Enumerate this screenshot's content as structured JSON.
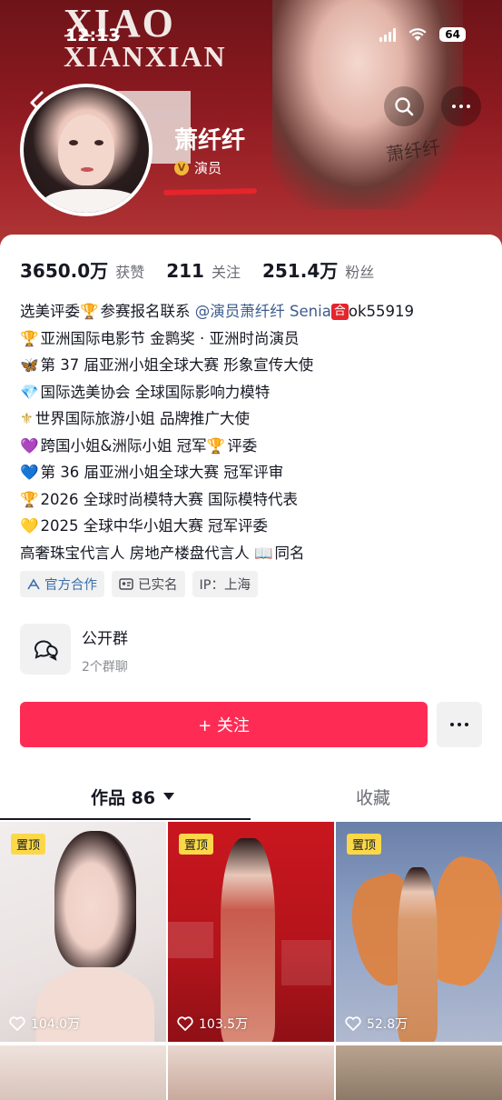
{
  "status": {
    "time": "12:13",
    "battery": "64"
  },
  "banner": {
    "line1": "XIAO",
    "line2": "XIANXIAN",
    "signature": "萧纤纤"
  },
  "profile": {
    "nickname": "萧纤纤",
    "verify_label": "演员",
    "verify_badge": "V"
  },
  "stats": [
    {
      "value": "3650.0万",
      "label": "获赞"
    },
    {
      "value": "211",
      "label": "关注"
    },
    {
      "value": "251.4万",
      "label": "粉丝"
    }
  ],
  "bio": {
    "l1a": "选美评委",
    "l1b": "参赛报名联系",
    "l1_mention": "@演员萧纤纤 Senia",
    "l1_tag": "合",
    "l1c": "ok55919",
    "l2": "亚洲国际电影节 金鹮奖 · 亚洲时尚演员",
    "l3": "第 37 届亚洲小姐全球大赛 形象宣传大使",
    "l4": "国际选美协会 全球国际影响力模特",
    "l5": "世界国际旅游小姐 品牌推广大使",
    "l6a": "跨国小姐&洲际小姐 冠军",
    "l6b": "评委",
    "l7": "第 36 届亚洲小姐全球大赛 冠军评审",
    "l8": "2026 全球时尚模特大赛 国际模特代表",
    "l9": "2025 全球中华小姐大赛 冠军评委",
    "l10a": "高奢珠宝代言人 房地产楼盘代言人",
    "l10b": "同名"
  },
  "chips": {
    "official": "官方合作",
    "realname": "已实名",
    "ip": "IP：上海"
  },
  "group": {
    "title": "公开群",
    "sub": "2个群聊"
  },
  "follow": {
    "label": "+ 关注"
  },
  "tabs": {
    "works": "作品 86",
    "collect": "收藏"
  },
  "posts": [
    {
      "pin": "置顶",
      "likes": "104.0万"
    },
    {
      "pin": "置顶",
      "likes": "103.5万"
    },
    {
      "pin": "置顶",
      "likes": "52.8万"
    }
  ],
  "colors": {
    "accent": "#fe2c55",
    "pin": "#fbd848",
    "mention": "#3c5c8e"
  }
}
